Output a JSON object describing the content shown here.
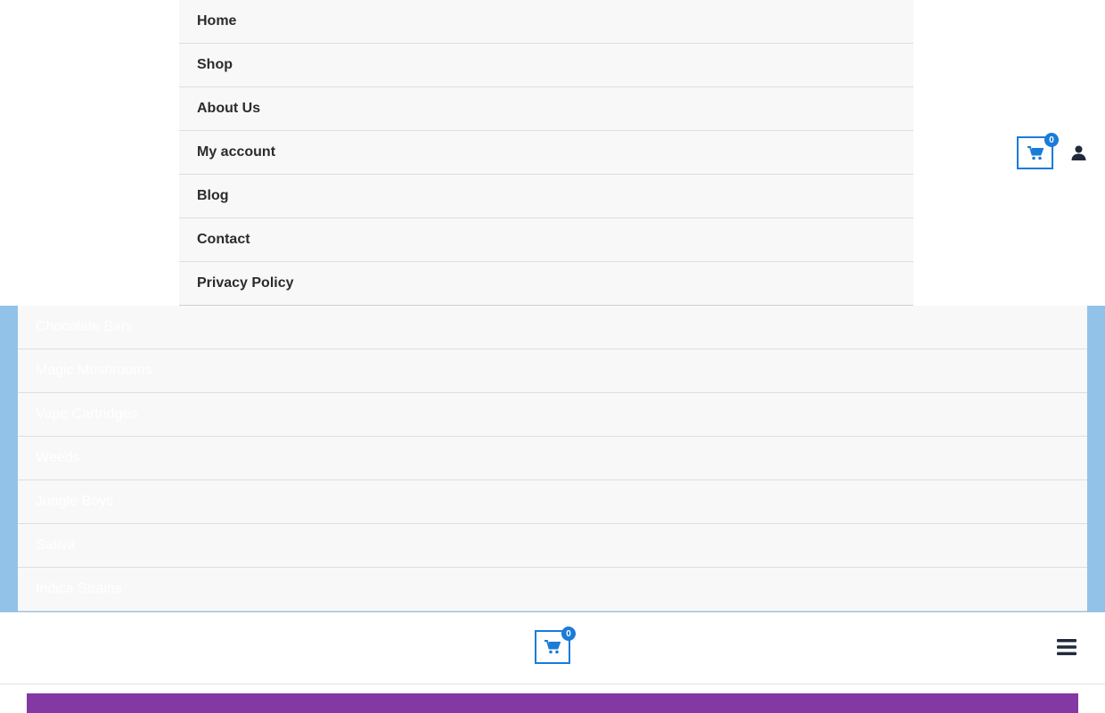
{
  "top_menu": {
    "items": [
      {
        "label": "Home"
      },
      {
        "label": "Shop"
      },
      {
        "label": "About Us"
      },
      {
        "label": "My account"
      },
      {
        "label": "Blog"
      },
      {
        "label": "Contact"
      },
      {
        "label": "Privacy Policy"
      }
    ]
  },
  "header": {
    "cart_count": "0",
    "cart_icon": "shopping-cart-icon",
    "user_icon": "user-icon"
  },
  "category_menu": {
    "items": [
      {
        "label": "Chocolate Bars"
      },
      {
        "label": "Magic Mushrooms"
      },
      {
        "label": "Vape Cartridges"
      },
      {
        "label": "Weeds"
      },
      {
        "label": "Jungle Boys"
      },
      {
        "label": "Sativa"
      },
      {
        "label": "Indica Strains"
      }
    ]
  },
  "mobile_header": {
    "cart_count": "0",
    "menu_icon": "hamburger-menu-icon"
  },
  "colors": {
    "accent_blue": "#1a7cd8",
    "frame_blue": "#92c2e8",
    "purple": "#8338a3"
  }
}
